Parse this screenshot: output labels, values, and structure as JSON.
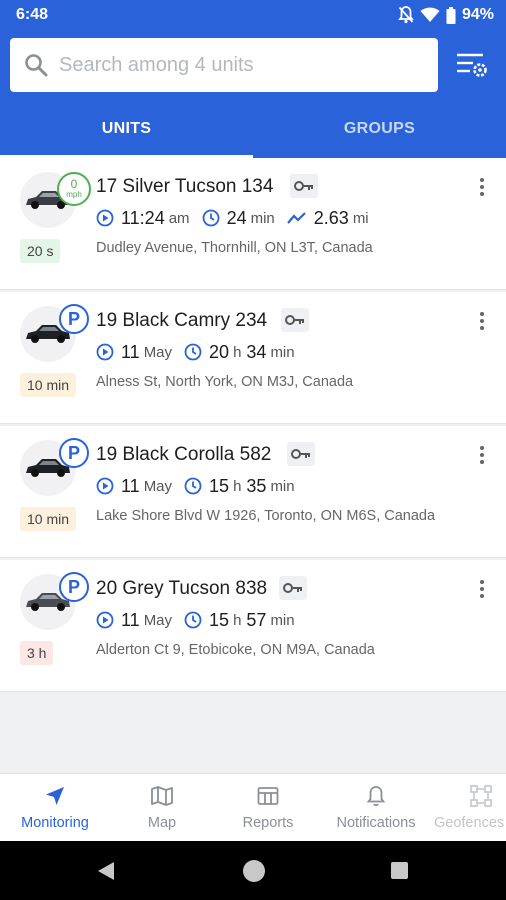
{
  "status_bar": {
    "time": "6:48",
    "battery": "94%"
  },
  "search": {
    "placeholder": "Search among 4 units"
  },
  "tabs": [
    {
      "label": "UNITS",
      "active": true
    },
    {
      "label": "GROUPS",
      "active": false
    }
  ],
  "units": [
    {
      "name": "17 Silver Tucson 134",
      "state": "moving",
      "speed": "0",
      "speed_unit": "mph",
      "time_main": "11:24",
      "time_sub": "am",
      "duration_main": "24",
      "duration_sub": "min",
      "distance_main": "2.63",
      "distance_sub": "mi",
      "address": "Dudley Avenue, Thornhill, ON L3T, Canada",
      "age": "20 s",
      "age_color": "green"
    },
    {
      "name": "19 Black Camry 234",
      "state": "parked",
      "parked_label": "P",
      "time_main": "11",
      "time_sub": "May",
      "duration_h": "20",
      "duration_h_unit": "h",
      "duration_main": "34",
      "duration_sub": "min",
      "address": "Alness St, North York, ON M3J, Canada",
      "age": "10 min",
      "age_color": "orange"
    },
    {
      "name": "19 Black Corolla 582",
      "state": "parked",
      "parked_label": "P",
      "time_main": "11",
      "time_sub": "May",
      "duration_h": "15",
      "duration_h_unit": "h",
      "duration_main": "35",
      "duration_sub": "min",
      "address": "Lake Shore Blvd W 1926, Toronto, ON M6S, Canada",
      "age": "10 min",
      "age_color": "orange"
    },
    {
      "name": "20 Grey Tucson 838",
      "state": "parked",
      "parked_label": "P",
      "time_main": "11",
      "time_sub": "May",
      "duration_h": "15",
      "duration_h_unit": "h",
      "duration_main": "57",
      "duration_sub": "min",
      "address": "Alderton Ct 9, Etobicoke, ON M9A, Canada",
      "age": "3 h",
      "age_color": "red"
    }
  ],
  "bottom_nav": [
    {
      "label": "Monitoring",
      "icon": "navigation-arrow-icon",
      "active": true
    },
    {
      "label": "Map",
      "icon": "map-icon",
      "active": false
    },
    {
      "label": "Reports",
      "icon": "reports-icon",
      "active": false
    },
    {
      "label": "Notifications",
      "icon": "bell-icon",
      "active": false
    },
    {
      "label": "Geofences",
      "icon": "geofence-icon",
      "active": false
    }
  ],
  "colors": {
    "primary": "#2a63d9",
    "moving": "#4caf50"
  }
}
